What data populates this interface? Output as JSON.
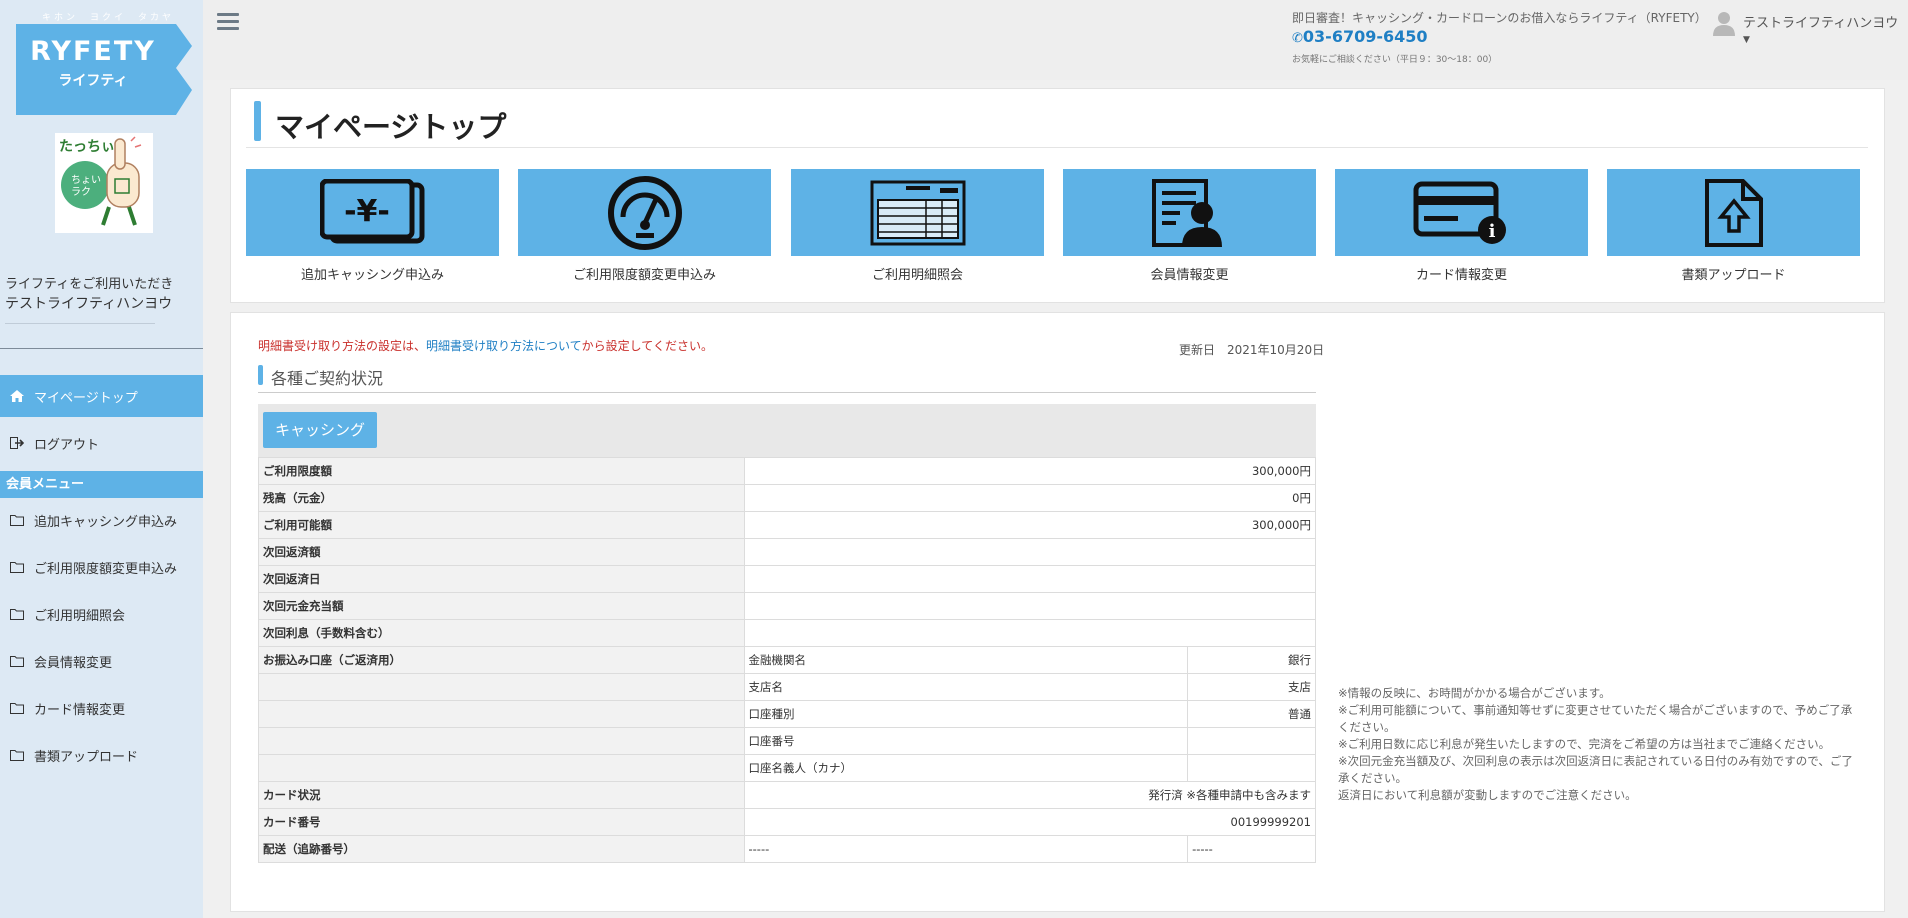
{
  "sidebar": {
    "logo_tagline": "キホン　ヨクイ　タカヤ",
    "logo_text": "RYFETY",
    "logo_sub": "ライフティ",
    "welcome_line1": "ライフティをご利用いただき",
    "welcome_line2": "テストライフティハンヨウ",
    "nav_top": [
      {
        "label": "マイページトップ",
        "icon": "home-icon"
      },
      {
        "label": "ログアウト",
        "icon": "logout-icon"
      }
    ],
    "menu_header": "会員メニュー",
    "menu_items": [
      {
        "label": "追加キャッシング申込み",
        "icon": "folder-icon"
      },
      {
        "label": "ご利用限度額変更申込み",
        "icon": "folder-icon"
      },
      {
        "label": "ご利用明細照会",
        "icon": "folder-icon"
      },
      {
        "label": "会員情報変更",
        "icon": "folder-icon"
      },
      {
        "label": "カード情報変更",
        "icon": "folder-icon"
      },
      {
        "label": "書類アップロード",
        "icon": "folder-icon"
      }
    ]
  },
  "header": {
    "tagline": "即日審査！キャッシング・カードローンのお借入ならライフティ（RYFETY）",
    "phone": "03-6709-6450",
    "hours": "お気軽にご相談ください（平日９：30～18：00）",
    "user_name": "テストライフティハンヨウ"
  },
  "main": {
    "page_title": "マイページトップ",
    "tiles": [
      {
        "label": "追加キャッシング申込み",
        "icon": "yen-bill-icon"
      },
      {
        "label": "ご利用限度額変更申込み",
        "icon": "gauge-icon"
      },
      {
        "label": "ご利用明細照会",
        "icon": "invoice-icon"
      },
      {
        "label": "会員情報変更",
        "icon": "member-card-icon"
      },
      {
        "label": "カード情報変更",
        "icon": "credit-card-info-icon"
      },
      {
        "label": "書類アップロード",
        "icon": "document-upload-icon"
      }
    ],
    "notice_pre": "明細書受け取り方法の設定は、",
    "notice_link": "明細書受け取り方法について",
    "notice_post": "から設定してください。",
    "update_date": "更新日　2021年10月20日",
    "section_title": "各種ご契約状況",
    "cashing_button": "キャッシング",
    "rows": [
      {
        "label": "ご利用限度額",
        "value": "300,000円"
      },
      {
        "label": "残高（元金）",
        "value": "0円"
      },
      {
        "label": "ご利用可能額",
        "value": "300,000円"
      },
      {
        "label": "次回返済額",
        "value": ""
      },
      {
        "label": "次回返済日",
        "value": ""
      },
      {
        "label": "次回元金充当額",
        "value": ""
      },
      {
        "label": "次回利息（手数料含む）",
        "value": ""
      }
    ],
    "bank_label": "お振込み口座（ご返済用）",
    "bank_rows": [
      {
        "name": "金融機関名",
        "value": "銀行"
      },
      {
        "name": "支店名",
        "value": "支店"
      },
      {
        "name": "口座種別",
        "value": "普通"
      },
      {
        "name": "口座番号",
        "value": ""
      },
      {
        "name": "口座名義人（カナ）",
        "value": ""
      }
    ],
    "card_status_label": "カード状況",
    "card_status_value": "発行済 ※各種申請中も含みます",
    "card_number_label": "カード番号",
    "card_number_value": "00199999201",
    "delivery_label": "配送（追跡番号）",
    "delivery_value1": "-----",
    "delivery_value2": "-----",
    "notes": [
      "※情報の反映に、お時間がかかる場合がございます。",
      "※ご利用可能額について、事前通知等せずに変更させていただく場合がございますので、予めご了承ください。",
      "※ご利用日数に応じ利息が発生いたしますので、完済をご希望の方は当社までご連絡ください。",
      "※次回元金充当額及び、次回利息の表示は次回返済日に表記されている日付のみ有効ですので、ご了承ください。",
      "返済日において利息額が変動しますのでご注意ください。"
    ]
  },
  "colors": {
    "accent": "#5eb2e6",
    "sidebar_bg": "#dde9f4",
    "notice_red": "#c9302c",
    "link_blue": "#1f7fc4"
  }
}
